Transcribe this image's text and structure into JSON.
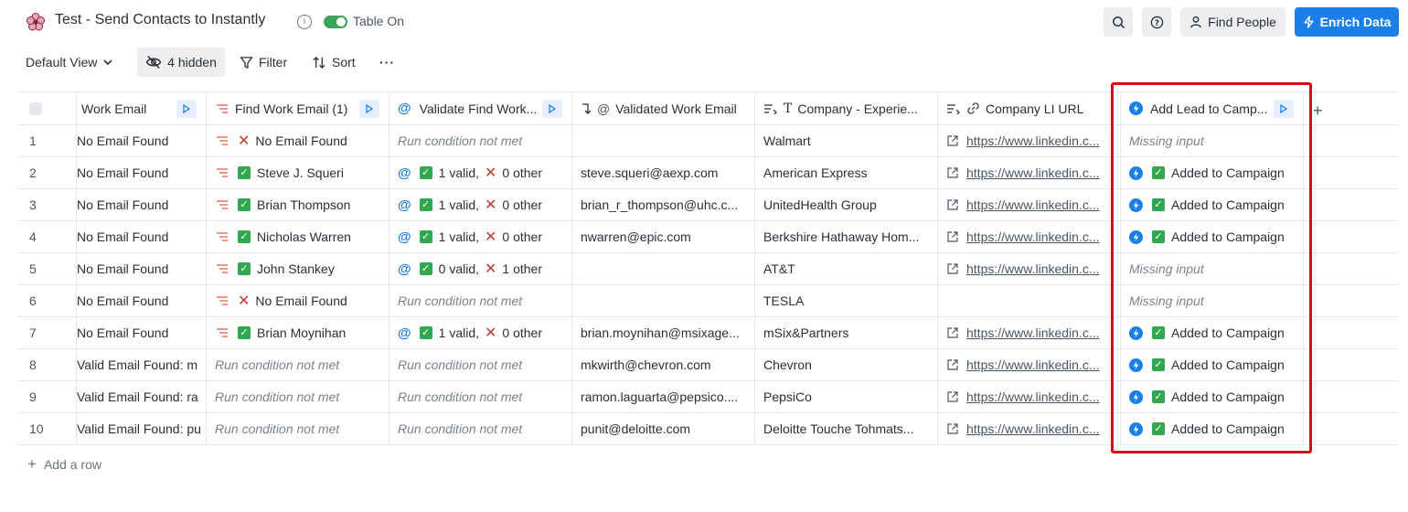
{
  "header": {
    "title": "Test - Send Contacts to Instantly",
    "toggle_label": "Table On",
    "find_people_label": "Find People",
    "enrich_data_label": "Enrich Data"
  },
  "toolbar": {
    "view_label": "Default View",
    "hidden_label": "4 hidden",
    "filter_label": "Filter",
    "sort_label": "Sort",
    "more_label": "···"
  },
  "columns": {
    "work_email": "Work Email",
    "find_work_email": "Find Work Email (1)",
    "validate": "Validate Find Work...",
    "validated_email": "Validated Work Email",
    "company_exp": "Company - Experie...",
    "company_li": "Company LI URL",
    "add_lead": "Add Lead to Camp..."
  },
  "rows": [
    {
      "n": "1",
      "work_email": "No Email Found",
      "find_status": "x",
      "find": "No Email Found",
      "val_status": "none",
      "val": "Run condition not met",
      "validated": "",
      "company": "Walmart",
      "li": "https://www.linkedin.c...",
      "add_status": "missing",
      "add": "Missing input"
    },
    {
      "n": "2",
      "work_email": "No Email Found",
      "find_status": "check",
      "find": "Steve J. Squeri",
      "val_status": "ok",
      "val_valid": "1 valid,",
      "val_other": "0 other",
      "validated": "steve.squeri@aexp.com",
      "company": "American Express",
      "li": "https://www.linkedin.c...",
      "add_status": "ok",
      "add": "Added to Campaign"
    },
    {
      "n": "3",
      "work_email": "No Email Found",
      "find_status": "check",
      "find": "Brian Thompson",
      "val_status": "ok",
      "val_valid": "1 valid,",
      "val_other": "0 other",
      "validated": "brian_r_thompson@uhc.c...",
      "company": "UnitedHealth Group",
      "li": "https://www.linkedin.c...",
      "add_status": "ok",
      "add": "Added to Campaign"
    },
    {
      "n": "4",
      "work_email": "No Email Found",
      "find_status": "check",
      "find": "Nicholas Warren",
      "val_status": "ok",
      "val_valid": "1 valid,",
      "val_other": "0 other",
      "validated": "nwarren@epic.com",
      "company": "Berkshire Hathaway Hom...",
      "li": "https://www.linkedin.c...",
      "add_status": "ok",
      "add": "Added to Campaign"
    },
    {
      "n": "5",
      "work_email": "No Email Found",
      "find_status": "check",
      "find": "John Stankey",
      "val_status": "ok",
      "val_valid": "0 valid,",
      "val_other": "1 other",
      "validated": "",
      "company": "AT&T",
      "li": "https://www.linkedin.c...",
      "add_status": "missing",
      "add": "Missing input"
    },
    {
      "n": "6",
      "work_email": "No Email Found",
      "find_status": "x",
      "find": "No Email Found",
      "val_status": "none",
      "val": "Run condition not met",
      "validated": "",
      "company": "TESLA",
      "li": "",
      "add_status": "missing",
      "add": "Missing input"
    },
    {
      "n": "7",
      "work_email": "No Email Found",
      "find_status": "check",
      "find": "Brian Moynihan",
      "val_status": "ok",
      "val_valid": "1 valid,",
      "val_other": "0 other",
      "validated": "brian.moynihan@msixage...",
      "company": "mSix&Partners",
      "li": "https://www.linkedin.c...",
      "add_status": "ok",
      "add": "Added to Campaign"
    },
    {
      "n": "8",
      "work_email": "Valid Email Found: m",
      "find_status": "none",
      "find": "Run condition not met",
      "val_status": "none",
      "val": "Run condition not met",
      "validated": "mkwirth@chevron.com",
      "company": "Chevron",
      "li": "https://www.linkedin.c...",
      "add_status": "ok",
      "add": "Added to Campaign"
    },
    {
      "n": "9",
      "work_email": "Valid Email Found: ra",
      "find_status": "none",
      "find": "Run condition not met",
      "val_status": "none",
      "val": "Run condition not met",
      "validated": "ramon.laguarta@pepsico....",
      "company": "PepsiCo",
      "li": "https://www.linkedin.c...",
      "add_status": "ok",
      "add": "Added to Campaign"
    },
    {
      "n": "10",
      "work_email": "Valid Email Found: pu",
      "find_status": "none",
      "find": "Run condition not met",
      "val_status": "none",
      "val": "Run condition not met",
      "validated": "punit@deloitte.com",
      "company": "Deloitte Touche Tohmats...",
      "li": "https://www.linkedin.c...",
      "add_status": "ok",
      "add": "Added to Campaign"
    }
  ],
  "footer": {
    "add_row_label": "Add a row"
  },
  "icons": {
    "logo": "flower-logo-icon",
    "search": "search-icon",
    "help": "help-icon",
    "person": "person-icon",
    "bolt": "lightning-icon",
    "eye_off": "eye-off-icon",
    "filter": "filter-icon",
    "sort": "sort-icon"
  },
  "colors": {
    "accent": "#1a7fe8",
    "success": "#2fa84f",
    "error": "#c0392b",
    "highlight": "#d0101a"
  }
}
